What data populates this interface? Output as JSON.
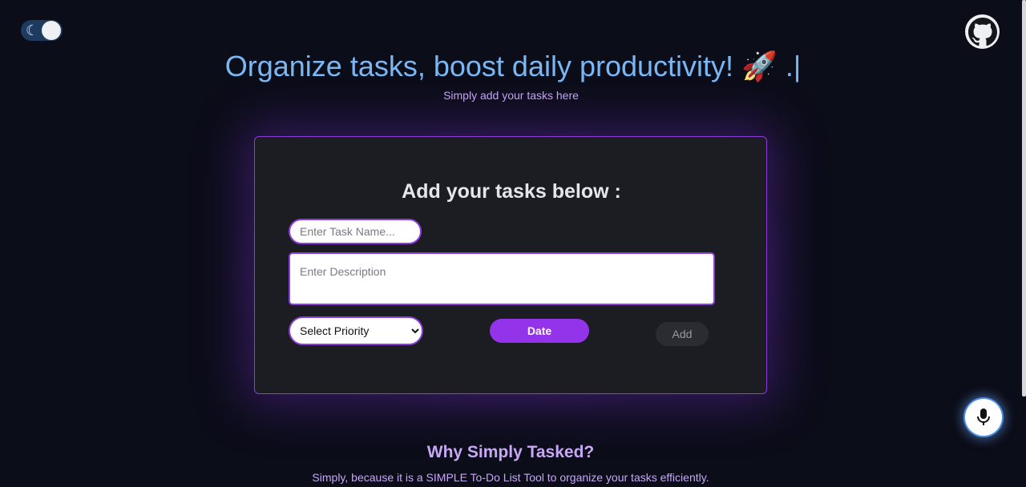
{
  "header": {
    "theme_toggle": {
      "icon": "moon-icon",
      "state": "dark"
    },
    "github_icon": "github-icon"
  },
  "hero": {
    "title": "Organize tasks, boost daily productivity! 🚀 .",
    "cursor": "|",
    "subtitle": "Simply add your tasks here"
  },
  "form": {
    "heading": "Add your tasks below :",
    "task_name_placeholder": "Enter Task Name...",
    "description_placeholder": "Enter Description",
    "priority_selected": "Select Priority",
    "date_label": "Date",
    "add_label": "Add"
  },
  "about": {
    "title": "Why Simply Tasked?",
    "text": "Simply, because it is a SIMPLE To-Do List Tool to organize your tasks efficiently."
  },
  "mic": {
    "icon": "microphone-icon"
  },
  "colors": {
    "background": "#0b0d18",
    "accent": "#9333ea",
    "title_blue": "#7ab8f5",
    "lavender": "#c8a7f5",
    "card": "#1c1d22"
  }
}
